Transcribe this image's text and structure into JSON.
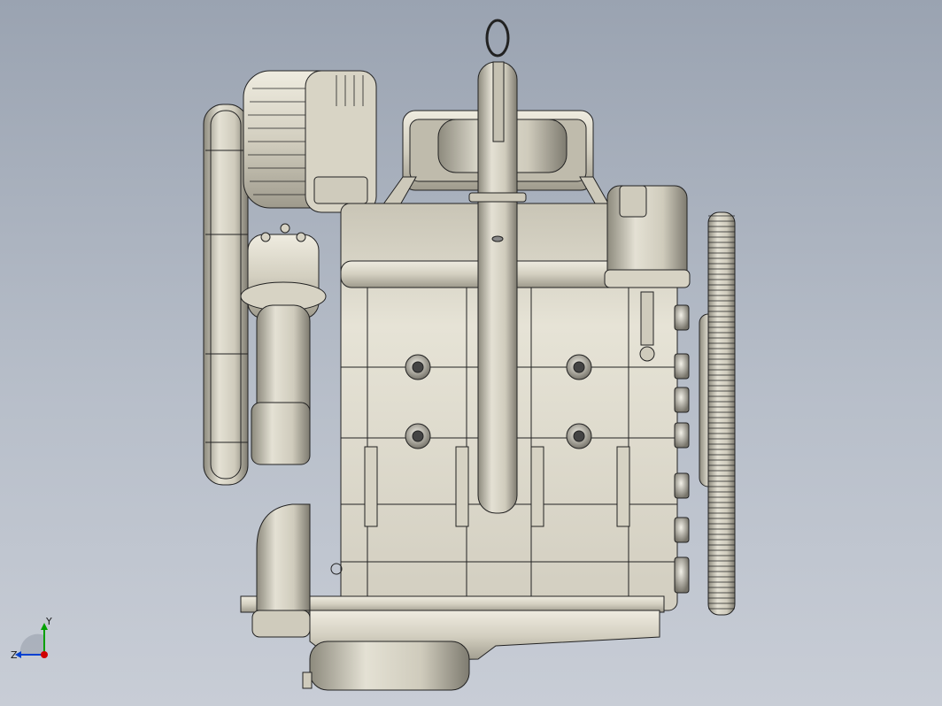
{
  "viewport": {
    "background_top": "#9aa3b1",
    "background_bottom": "#c8cdd6",
    "model_fill": "#d9d6c8",
    "model_shade": "#a9a596",
    "edge_color": "#222222"
  },
  "triad": {
    "x_label": "",
    "y_label": "Y",
    "z_label": "Z",
    "x_color": "#d00000",
    "y_color": "#00a000",
    "z_color": "#0040d0"
  }
}
